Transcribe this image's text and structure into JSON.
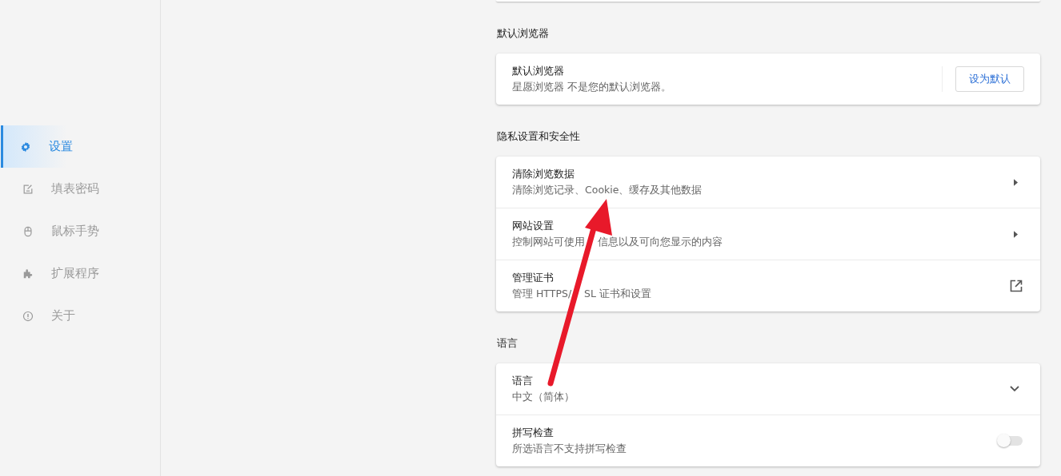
{
  "sidebar": {
    "items": [
      {
        "label": "设置",
        "selected": true
      },
      {
        "label": "填表密码",
        "selected": false
      },
      {
        "label": "鼠标手势",
        "selected": false
      },
      {
        "label": "扩展程序",
        "selected": false
      },
      {
        "label": "关于",
        "selected": false
      }
    ]
  },
  "sections": [
    {
      "heading": "默认浏览器",
      "rows": [
        {
          "kind": "button",
          "title": "默认浏览器",
          "subtitle": "星愿浏览器 不是您的默认浏览器。",
          "button": "设为默认"
        }
      ]
    },
    {
      "heading": "隐私设置和安全性",
      "rows": [
        {
          "kind": "arrow",
          "title": "清除浏览数据",
          "subtitle": "清除浏览记录、Cookie、缓存及其他数据"
        },
        {
          "kind": "arrow",
          "title": "网站设置",
          "subtitle_parts": [
            "控制网站可使用",
            "信息以及可向您显示的内容"
          ]
        },
        {
          "kind": "external",
          "title": "管理证书",
          "subtitle_parts": [
            "管理 HTTPS/",
            "SL 证书和设置"
          ]
        }
      ]
    },
    {
      "heading": "语言",
      "rows": [
        {
          "kind": "expand",
          "title": "语言",
          "subtitle": "中文（简体）",
          "expanded": false
        },
        {
          "kind": "toggle",
          "title": "拼写检查",
          "subtitle": "所选语言不支持拼写检查",
          "on": false
        }
      ]
    }
  ],
  "annotation": {
    "kind": "arrow"
  }
}
